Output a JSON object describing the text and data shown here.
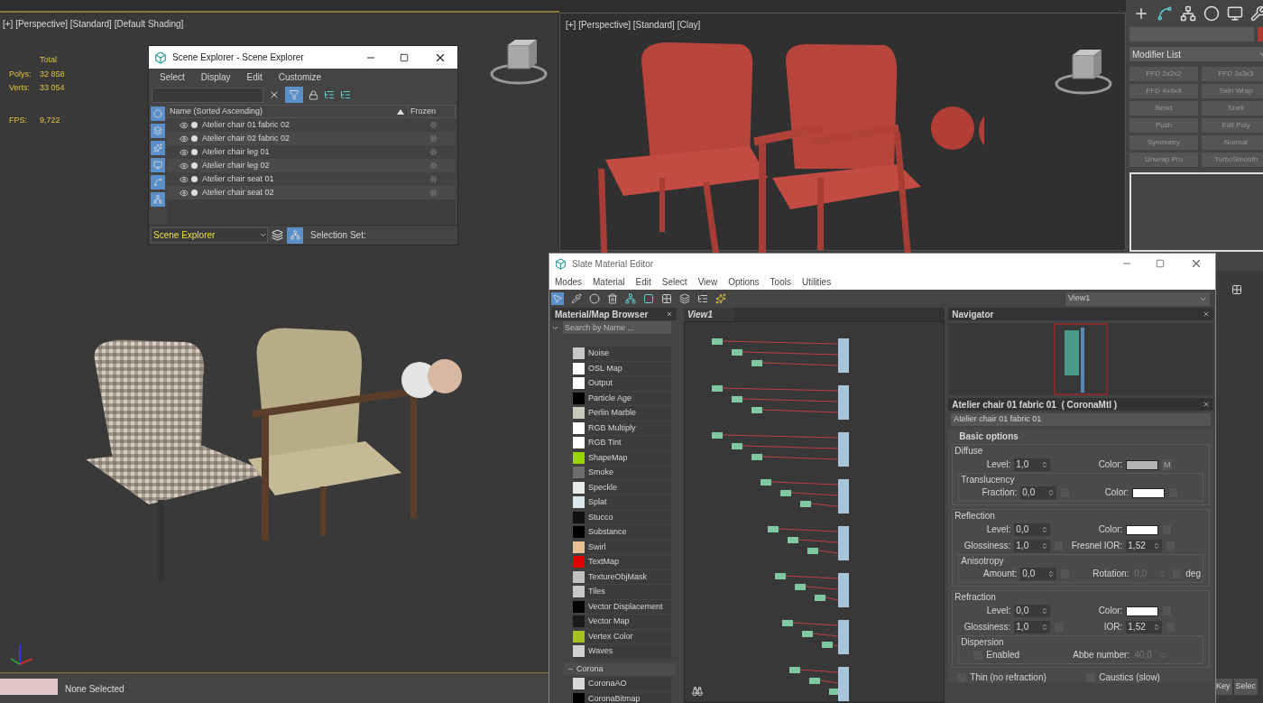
{
  "left_viewport": {
    "label": "[+] [Perspective] [Standard] [Default Shading]",
    "stats_heading": "Total",
    "stats": [
      {
        "label": "Polys:",
        "value": "32 858"
      },
      {
        "label": "Verts:",
        "value": "33 054"
      }
    ],
    "fps": {
      "label": "FPS:",
      "value": "9,722"
    }
  },
  "right_viewport": {
    "label": "[+] [Perspective] [Standard] [Clay]"
  },
  "command_panel": {
    "modifier_list": "Modifier List",
    "modifiers": [
      "FFD 2x2x2",
      "FFD 3x3x3",
      "FFD 4x4x4",
      "Skin Wrap",
      "Bend",
      "Shell",
      "Push",
      "Edit Poly",
      "Symmetry",
      "Normal",
      "Unwrap Pro",
      "TurboSmooth"
    ]
  },
  "scene_explorer": {
    "title": "Scene Explorer - Scene Explorer",
    "menu": [
      "Select",
      "Display",
      "Edit",
      "Customize"
    ],
    "filter_on": true,
    "columns": [
      "Name (Sorted Ascending)",
      "Frozen"
    ],
    "rows": [
      "Atelier chair 01 fabric 02",
      "Atelier chair 02 fabric 02",
      "Atelier chair leg 01",
      "Atelier chair leg 02",
      "Atelier chair seat 01",
      "Atelier chair seat 02"
    ],
    "view": "Scene Explorer",
    "selection_set_label": "Selection Set:"
  },
  "slate": {
    "title": "Slate Material Editor",
    "menu": [
      "Modes",
      "Material",
      "Edit",
      "Select",
      "View",
      "Options",
      "Tools",
      "Utilities"
    ],
    "view_dropdown": "View1",
    "browser": {
      "title": "Material/Map Browser",
      "placeholder": "Search by Name ...",
      "items": [
        {
          "name": "Noise",
          "color": "#c8c8c8"
        },
        {
          "name": "OSL Map",
          "color": "#ffffff"
        },
        {
          "name": "Output",
          "color": "#ffffff"
        },
        {
          "name": "Particle Age",
          "color": "#000000"
        },
        {
          "name": "Perlin Marble",
          "color": "#c9cbb8"
        },
        {
          "name": "RGB Multiply",
          "color": "#ffffff"
        },
        {
          "name": "RGB Tint",
          "color": "#ffffff"
        },
        {
          "name": "ShapeMap",
          "color": "#9ad400"
        },
        {
          "name": "Smoke",
          "color": "#6d6d6d"
        },
        {
          "name": "Speckle",
          "color": "#e8ece8"
        },
        {
          "name": "Splat",
          "color": "#d8e8ea"
        },
        {
          "name": "Stucco",
          "color": "#111111"
        },
        {
          "name": "Substance",
          "color": "#000000"
        },
        {
          "name": "Swirl",
          "color": "#e8c096"
        },
        {
          "name": "TextMap",
          "color": "#e00000"
        },
        {
          "name": "TextureObjMask",
          "color": "#c0c0c0"
        },
        {
          "name": "Tiles",
          "color": "#c8c8c8"
        },
        {
          "name": "Vector Displacement",
          "color": "#000000"
        },
        {
          "name": "Vector Map",
          "color": "#1a1a1a"
        },
        {
          "name": "Vertex Color",
          "color": "#a8c020"
        },
        {
          "name": "Waves",
          "color": "#d0d0d0"
        }
      ],
      "group": {
        "title": "Corona",
        "expanded": true,
        "items": [
          {
            "name": "CoronaAO",
            "color": "#d8d8d8"
          },
          {
            "name": "CoronaBitmap",
            "color": "#000000"
          }
        ]
      }
    },
    "view_tab": "View1",
    "navigator": "Navigator",
    "material": {
      "title": "Atelier chair 01 fabric 01  ( CoronaMtl )",
      "name": "Atelier chair 01 fabric 01",
      "rollout": "Basic options",
      "groups": [
        {
          "title": "Diffuse",
          "rows": [
            [
              {
                "kind": "spinner",
                "label": "Level:",
                "value": "1,0"
              },
              {
                "kind": "swatch",
                "label": "Color:",
                "color": "#b4b4b4",
                "map": "M"
              }
            ]
          ],
          "sub": {
            "title": "Translucency",
            "rows": [
              [
                {
                  "kind": "spinner",
                  "label": "Fraction:",
                  "value": "0,0",
                  "slot": true
                },
                {
                  "kind": "swatch",
                  "label": "Color:",
                  "color": "#ffffff",
                  "slot": true
                }
              ]
            ]
          }
        },
        {
          "title": "Reflection",
          "rows": [
            [
              {
                "kind": "spinner",
                "label": "Level:",
                "value": "0,0"
              },
              {
                "kind": "swatch",
                "label": "Color:",
                "color": "#ffffff",
                "slot": true
              }
            ],
            [
              {
                "kind": "spinner",
                "label": "Glossiness:",
                "value": "1,0",
                "slot": true
              },
              {
                "kind": "spinner",
                "label": "Fresnel IOR:",
                "value": "1,52",
                "slot": true
              }
            ]
          ],
          "sub": {
            "title": "Anisotropy",
            "rows": [
              [
                {
                  "kind": "spinner",
                  "label": "Amount:",
                  "value": "0,0",
                  "slot": true
                },
                {
                  "kind": "spinner",
                  "label": "Rotation:",
                  "value": "0,0",
                  "disabled": true,
                  "slot": true,
                  "unit": "deg"
                }
              ]
            ]
          }
        },
        {
          "title": "Refraction",
          "rows": [
            [
              {
                "kind": "spinner",
                "label": "Level:",
                "value": "0,0"
              },
              {
                "kind": "swatch",
                "label": "Color:",
                "color": "#ffffff",
                "slot": true
              }
            ],
            [
              {
                "kind": "spinner",
                "label": "Glossiness:",
                "value": "1,0",
                "slot": true
              },
              {
                "kind": "spinner",
                "label": "IOR:",
                "value": "1,52",
                "slot": true
              }
            ]
          ],
          "sub": {
            "title": "Dispersion",
            "rows": [
              [
                {
                  "kind": "checkbox",
                  "label": "Enabled",
                  "checked": false
                },
                {
                  "kind": "spinner",
                  "label": "Abbe number:",
                  "value": "40,0",
                  "disabled": true
                }
              ]
            ]
          }
        }
      ],
      "options": [
        {
          "label": "Thin (no refraction)",
          "checked": false
        },
        {
          "label": "Caustics (slow)",
          "checked": false
        }
      ]
    }
  },
  "status": {
    "prompt": "None Selected"
  },
  "key_buttons": [
    "Key",
    "Selec"
  ]
}
